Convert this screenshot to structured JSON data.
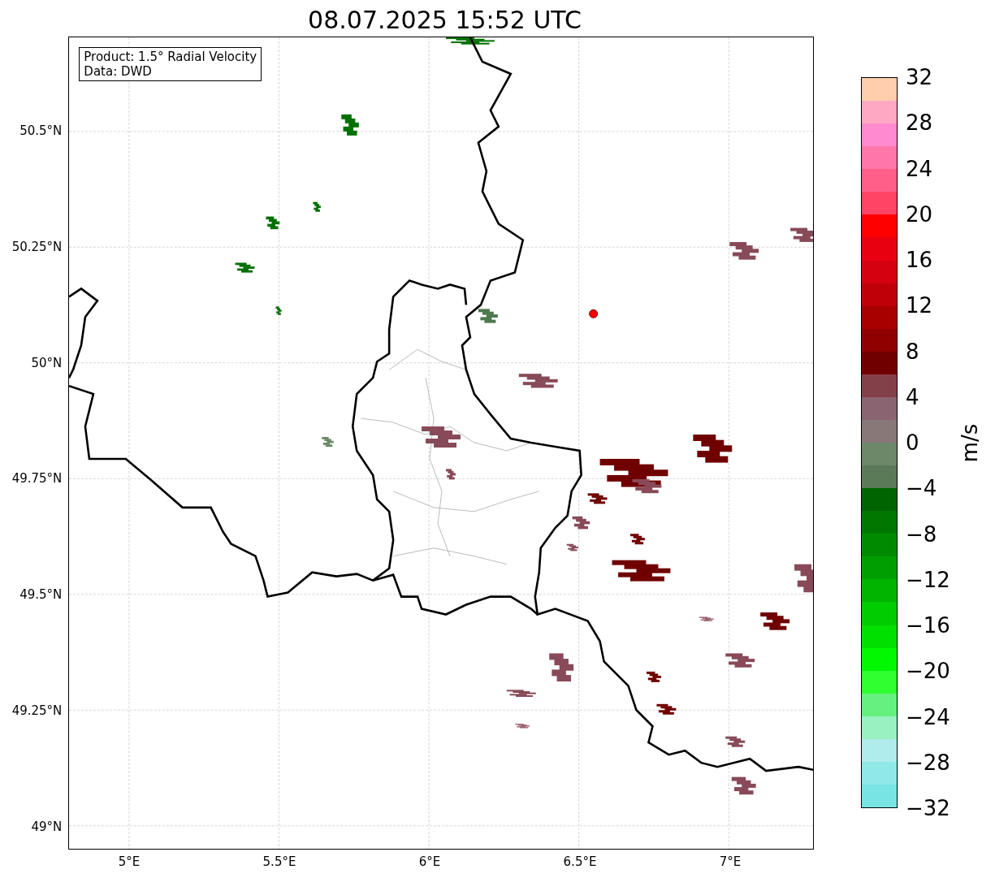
{
  "title": "08.07.2025 15:52 UTC",
  "info_box": [
    "Product: 1.5° Radial Velocity",
    "Data: DWD"
  ],
  "lat_ticks": [
    "50.5°N",
    "50.25°N",
    "50°N",
    "49.75°N",
    "49.5°N",
    "49.25°N",
    "49°N"
  ],
  "lon_ticks": [
    "5°E",
    "5.5°E",
    "6°E",
    "6.5°E",
    "7°E"
  ],
  "colorbar": {
    "label": "m/s",
    "ticks": [
      "32",
      "28",
      "24",
      "20",
      "16",
      "12",
      "8",
      "4",
      "0",
      "−4",
      "−8",
      "−12",
      "−16",
      "−20",
      "−24",
      "−28",
      "−32"
    ],
    "bands": [
      {
        "color": "#ffcfad"
      },
      {
        "color": "#ffa8c4"
      },
      {
        "color": "#ff8ad0"
      },
      {
        "color": "#ff77aa"
      },
      {
        "color": "#ff5f88"
      },
      {
        "color": "#ff4466"
      },
      {
        "color": "#ff0000"
      },
      {
        "color": "#e80010"
      },
      {
        "color": "#d50010"
      },
      {
        "color": "#c00008"
      },
      {
        "color": "#a80000"
      },
      {
        "color": "#900000"
      },
      {
        "color": "#700000"
      },
      {
        "color": "#844048"
      },
      {
        "color": "#8a6470"
      },
      {
        "color": "#887878"
      },
      {
        "color": "#6c8868"
      },
      {
        "color": "#5a7a58"
      },
      {
        "color": "#006400"
      },
      {
        "color": "#007800"
      },
      {
        "color": "#008a00"
      },
      {
        "color": "#009e00"
      },
      {
        "color": "#00b400"
      },
      {
        "color": "#00cc00"
      },
      {
        "color": "#00e000"
      },
      {
        "color": "#00f800"
      },
      {
        "color": "#30ff30"
      },
      {
        "color": "#66f080"
      },
      {
        "color": "#99f0c0"
      },
      {
        "color": "#b0ecec"
      },
      {
        "color": "#90e8e8"
      },
      {
        "color": "#78e4e4"
      }
    ]
  }
}
